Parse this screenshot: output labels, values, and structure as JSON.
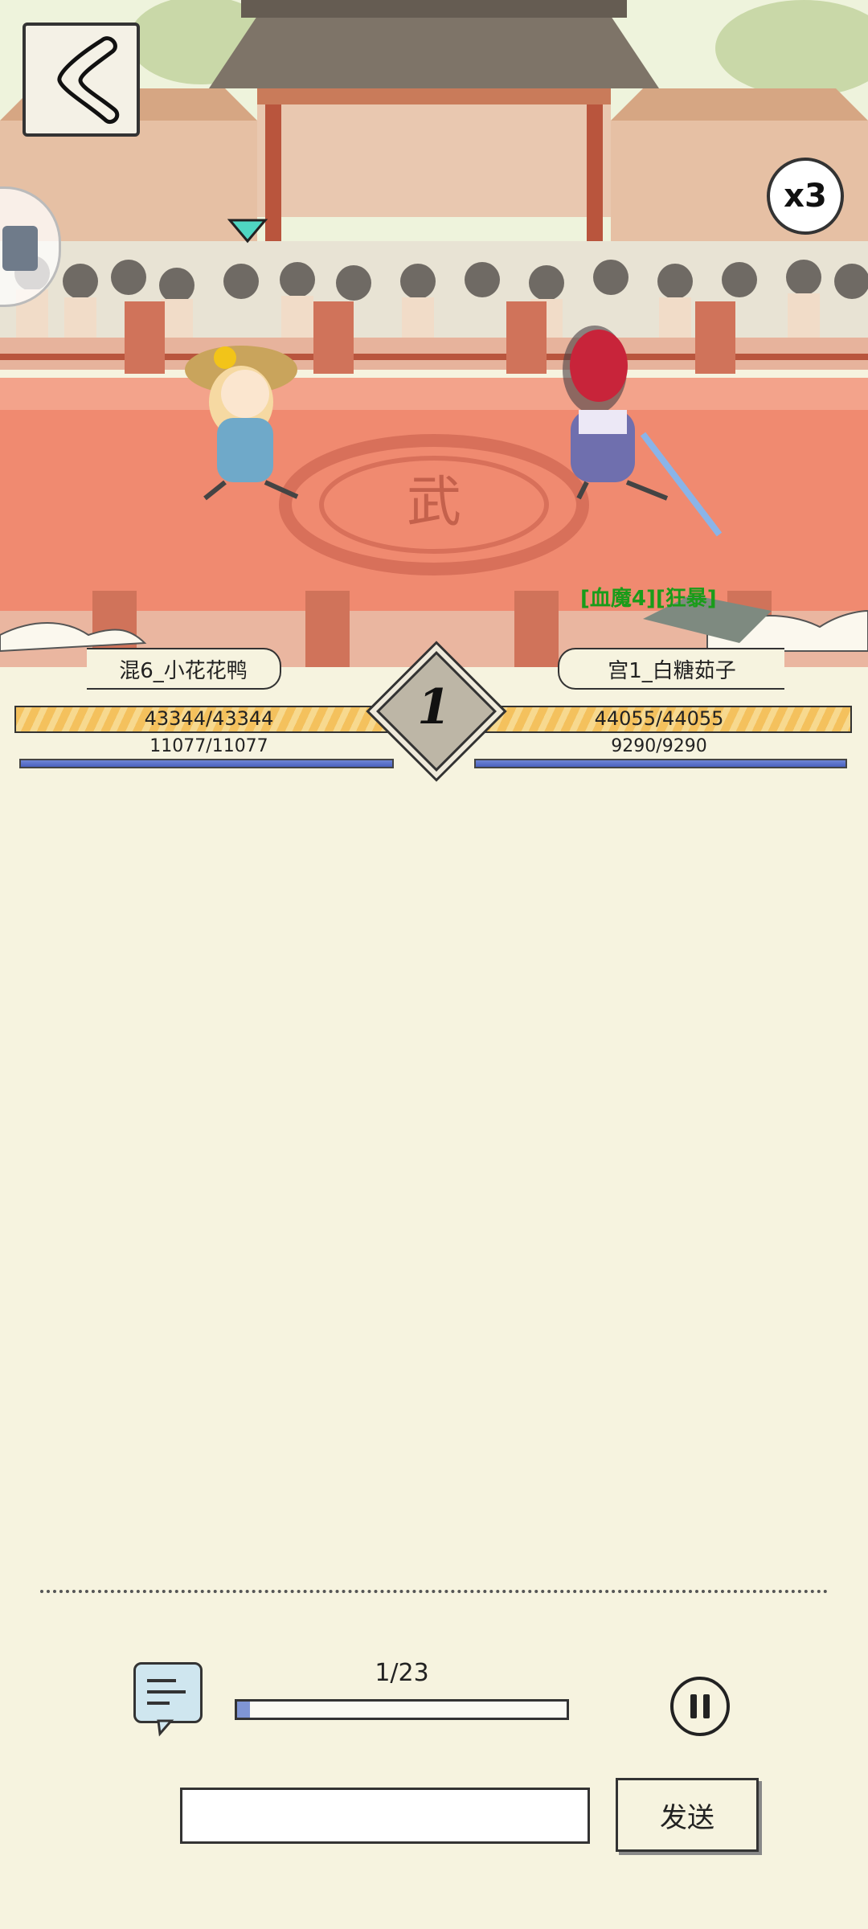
{
  "battle": {
    "speed_label": "x3",
    "turn_number": "1",
    "left_fighter": {
      "name": "混6_小花花鸭",
      "hp_text": "43344/43344",
      "mp_text": "11077/11077",
      "hp_fraction": 1.0,
      "mp_fraction": 1.0
    },
    "right_fighter": {
      "name": "宫1_白糖茹子",
      "hp_text": "44055/44055",
      "mp_text": "9290/9290",
      "hp_fraction": 1.0,
      "mp_fraction": 1.0,
      "tags": "[血魔4][狂暴]"
    },
    "arena_emblem": "武"
  },
  "playback": {
    "progress_text": "1/23",
    "progress_fraction": 0.04
  },
  "chat": {
    "input_value": "",
    "send_label": "发送"
  },
  "colors": {
    "hp_bar": "#f4c15d",
    "mp_bar": "#5a71c8",
    "arena_floor": "#f08a70",
    "tag_green": "#1a9c1a",
    "paper": "#f6f3df"
  },
  "icons": {
    "back": "back-chevron-icon",
    "chat": "chat-bubble-icon",
    "pause": "pause-icon",
    "turn_marker": "triangle-marker-icon"
  }
}
